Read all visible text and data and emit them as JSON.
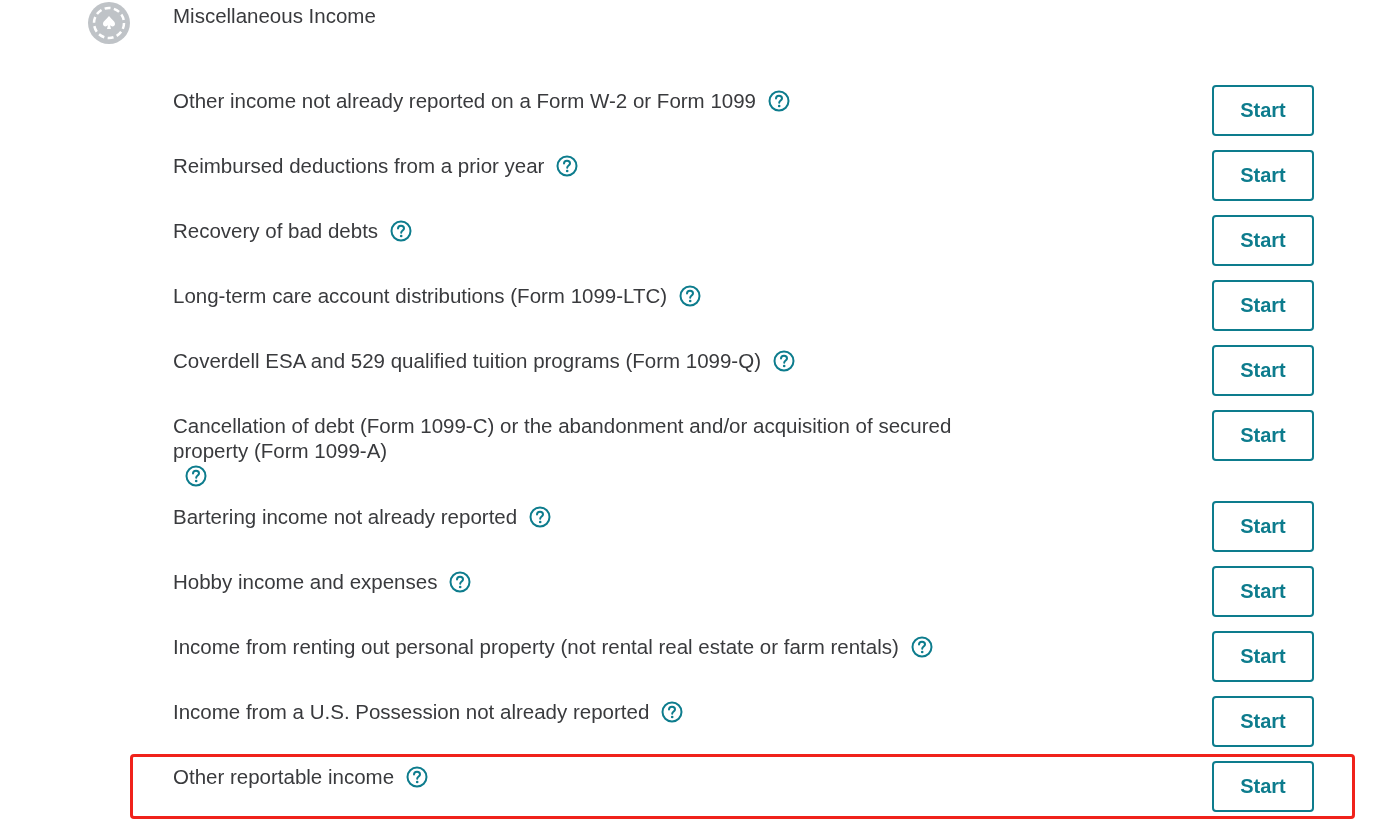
{
  "section": {
    "title": "Miscellaneous Income"
  },
  "rows": [
    {
      "label": "Other income not already reported on a Form W-2 or Form 1099",
      "button": "Start",
      "highlighted": false
    },
    {
      "label": "Reimbursed deductions from a prior year",
      "button": "Start",
      "highlighted": false
    },
    {
      "label": "Recovery of bad debts",
      "button": "Start",
      "highlighted": false
    },
    {
      "label": "Long-term care account distributions (Form 1099-LTC)",
      "button": "Start",
      "highlighted": false
    },
    {
      "label": "Coverdell ESA and 529 qualified tuition programs (Form 1099-Q)",
      "button": "Start",
      "highlighted": false
    },
    {
      "label": "Cancellation of debt (Form 1099-C) or the abandonment and/or acquisition of secured property (Form 1099-A)",
      "button": "Start",
      "highlighted": false
    },
    {
      "label": "Bartering income not already reported",
      "button": "Start",
      "highlighted": false
    },
    {
      "label": "Hobby income and expenses",
      "button": "Start",
      "highlighted": false
    },
    {
      "label": "Income from renting out personal property (not rental real estate or farm rentals)",
      "button": "Start",
      "highlighted": false
    },
    {
      "label": "Income from a U.S. Possession not already reported",
      "button": "Start",
      "highlighted": false
    },
    {
      "label": "Other reportable income",
      "button": "Start",
      "highlighted": true
    }
  ]
}
